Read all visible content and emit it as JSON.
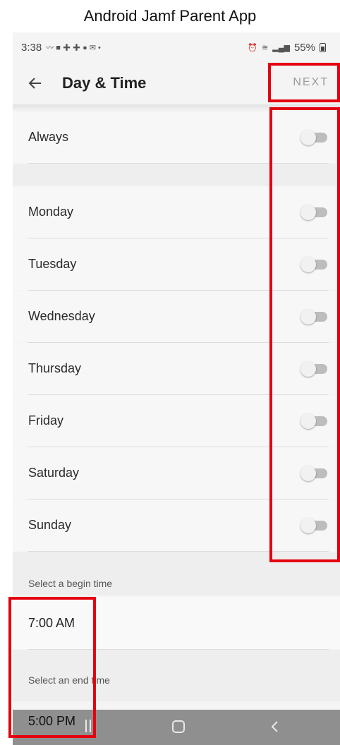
{
  "caption": "Android Jamf Parent App",
  "status_bar": {
    "time": "3:38",
    "battery": "55%"
  },
  "app_bar": {
    "title": "Day & Time",
    "next_label": "NEXT"
  },
  "always_row": {
    "label": "Always",
    "on": false
  },
  "days": [
    {
      "label": "Monday",
      "on": false
    },
    {
      "label": "Tuesday",
      "on": false
    },
    {
      "label": "Wednesday",
      "on": false
    },
    {
      "label": "Thursday",
      "on": false
    },
    {
      "label": "Friday",
      "on": false
    },
    {
      "label": "Saturday",
      "on": false
    },
    {
      "label": "Sunday",
      "on": false
    }
  ],
  "begin_time": {
    "label": "Select a begin time",
    "value": "7:00 AM"
  },
  "end_time": {
    "label": "Select an end time",
    "value": "5:00 PM"
  },
  "colors": {
    "highlight": "#e4000f",
    "toggle_off_track": "#bdbdbd",
    "nav_bar": "#8f8f8f"
  }
}
